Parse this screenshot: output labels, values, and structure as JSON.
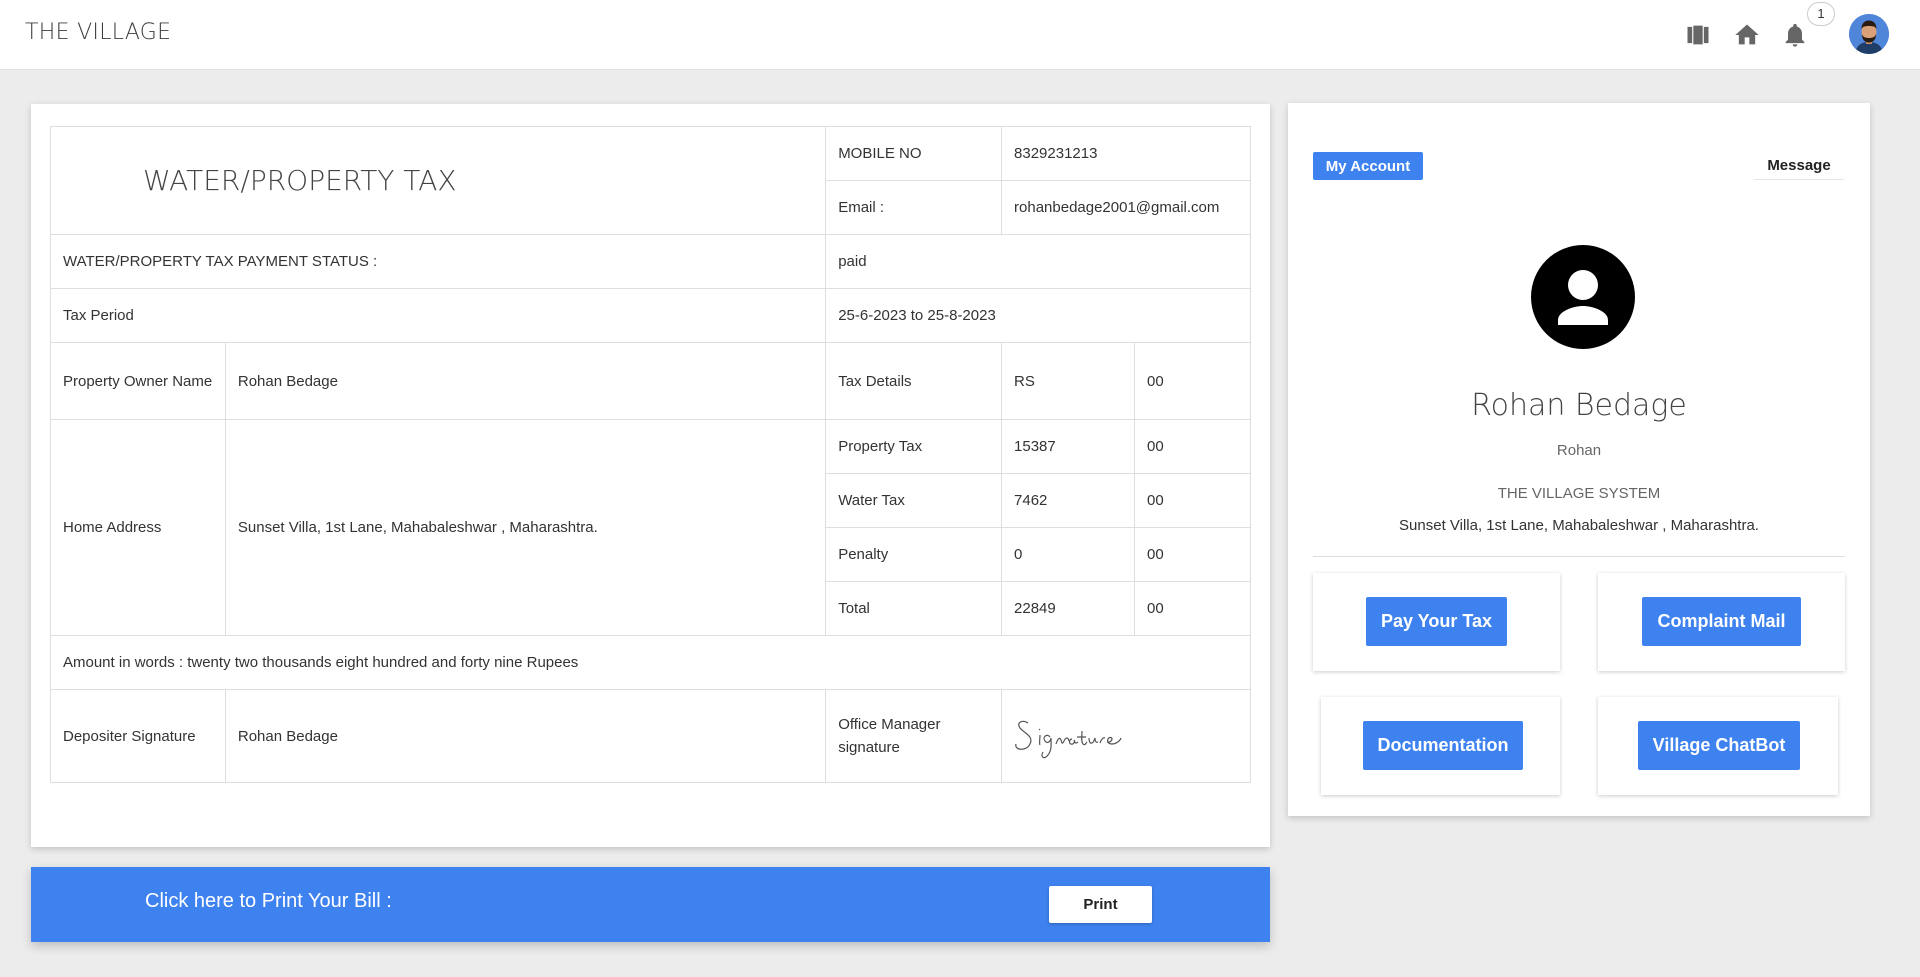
{
  "header": {
    "brand": "THE VILLAGE",
    "icons": [
      "book-icon",
      "home-icon",
      "bell-icon"
    ],
    "notification_count": "1"
  },
  "bill": {
    "title": "WATER/PROPERTY TAX",
    "mobile_label": "MOBILE NO",
    "mobile_value": "8329231213",
    "email_label": "Email :",
    "email_value": "rohanbedage2001@gmail.com",
    "status_label": "WATER/PROPERTY TAX PAYMENT STATUS :",
    "status_value": "paid",
    "period_label": "Tax Period",
    "period_value": "25-6-2023 to 25-8-2023",
    "owner_label": "Property Owner Name",
    "owner_value": "Rohan Bedage",
    "tax_details_label": "Tax Details",
    "currency": "RS",
    "currency_paise": "00",
    "address_label": "Home Address",
    "address_value": "Sunset Villa, 1st Lane, Mahabaleshwar , Maharashtra.",
    "rows": [
      {
        "label": "Property Tax",
        "amount": "15387",
        "paise": "00"
      },
      {
        "label": "Water Tax",
        "amount": "7462",
        "paise": "00"
      },
      {
        "label": "Penalty",
        "amount": "0",
        "paise": "00"
      },
      {
        "label": "Total",
        "amount": "22849",
        "paise": "00"
      }
    ],
    "amount_words": "Amount in words : twenty two thousands eight hundred and forty nine Rupees",
    "depositer_label": "Depositer Signature",
    "depositer_value": "Rohan Bedage",
    "manager_label": "Office Manager signature",
    "manager_signature": "Signature"
  },
  "print_bar": {
    "text": "Click here to Print Your Bill :",
    "button": "Print"
  },
  "profile": {
    "tab_account": "My Account",
    "tab_message": "Message",
    "name": "Rohan Bedage",
    "username": "Rohan",
    "system": "THE VILLAGE SYSTEM",
    "address": "Sunset Villa, 1st Lane, Mahabaleshwar , Maharashtra.",
    "actions": [
      "Pay Your Tax",
      "Complaint Mail",
      "Documentation",
      "Village ChatBot"
    ]
  },
  "colors": {
    "accent": "#3e82f0",
    "background": "#ececec"
  }
}
